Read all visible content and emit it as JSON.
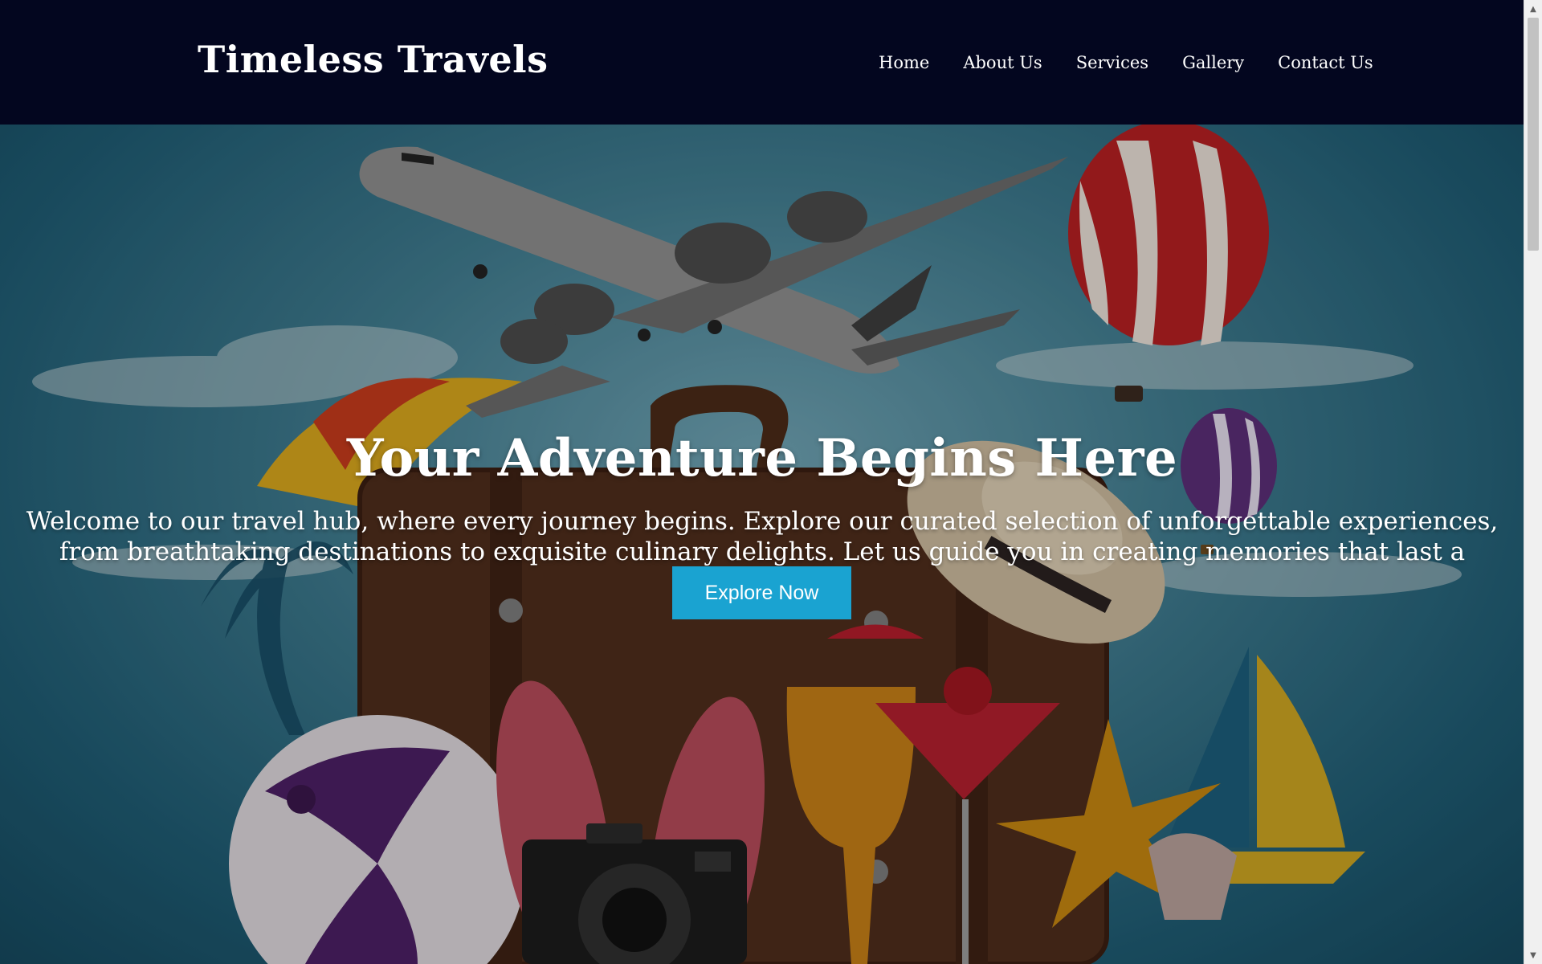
{
  "header": {
    "brand": "Timeless Travels",
    "nav": [
      "Home",
      "About Us",
      "Services",
      "Gallery",
      "Contact Us"
    ]
  },
  "hero": {
    "title": "Your Adventure Begins Here",
    "text": "Welcome to our travel hub, where every journey begins. Explore our curated selection of unforgettable experiences, from breathtaking destinations to exquisite culinary delights. Let us guide you in creating memories that last a lifetime..",
    "cta_label": "Explore Now"
  },
  "colors": {
    "header_bg": "#03061f",
    "cta_bg": "#1aa3d1",
    "hero_sky": "#3f7a8d"
  },
  "icons": {
    "scroll_up": "scroll-up-arrow-icon",
    "scroll_down": "scroll-down-arrow-icon"
  }
}
